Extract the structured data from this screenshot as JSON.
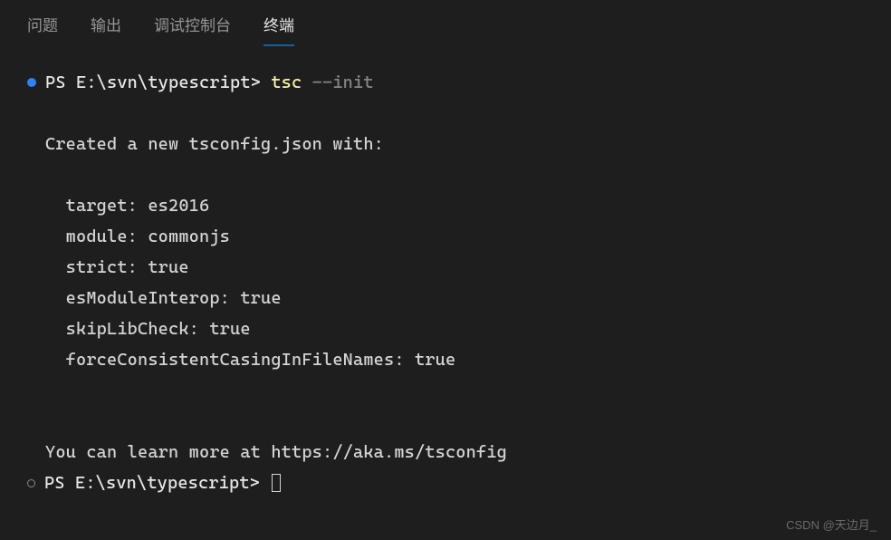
{
  "tabs": {
    "problems": "问题",
    "output": "输出",
    "debug_console": "调试控制台",
    "terminal": "终端"
  },
  "terminal": {
    "prompt1": "PS E:\\svn\\typescript> ",
    "command": "tsc",
    "command_arg": " --init",
    "output_header": "Created a new tsconfig.json with:",
    "config_lines": {
      "target": "  target: es2016",
      "module": "  module: commonjs",
      "strict": "  strict: true",
      "esModuleInterop": "  esModuleInterop: true",
      "skipLibCheck": "  skipLibCheck: true",
      "forceConsistent": "  forceConsistentCasingInFileNames: true"
    },
    "learn_more": "You can learn more at https://aka.ms/tsconfig",
    "prompt2": "PS E:\\svn\\typescript> "
  },
  "watermark": "CSDN @天边月_"
}
